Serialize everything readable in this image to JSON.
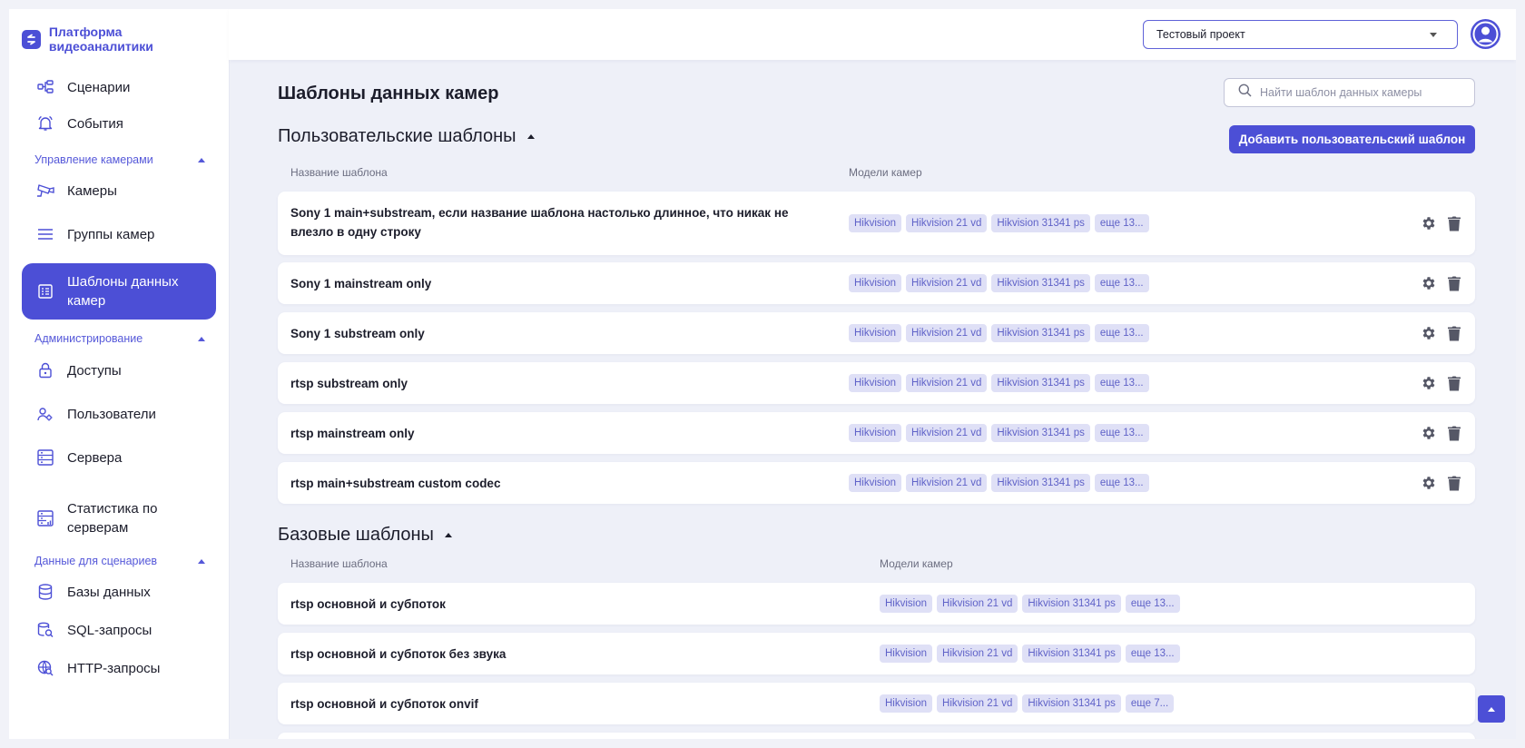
{
  "app": {
    "title": "Платформа видеоаналитики"
  },
  "sidebar": {
    "items": [
      {
        "label": "Сценарии",
        "icon": "scenarios-icon"
      },
      {
        "label": "События",
        "icon": "bell-icon"
      }
    ],
    "sections": [
      {
        "title": "Управление камерами",
        "items": [
          {
            "label": "Камеры",
            "icon": "camera-icon"
          },
          {
            "label": "Группы камер",
            "icon": "list-icon"
          },
          {
            "label": "Шаблоны данных камер",
            "icon": "template-icon",
            "active": true
          }
        ]
      },
      {
        "title": "Администрирование",
        "items": [
          {
            "label": "Доступы",
            "icon": "lock-icon"
          },
          {
            "label": "Пользователи",
            "icon": "users-icon"
          },
          {
            "label": "Сервера",
            "icon": "server-icon"
          },
          {
            "label": "Статистика по серверам",
            "icon": "server-stats-icon"
          }
        ]
      },
      {
        "title": "Данные для сценариев",
        "items": [
          {
            "label": "Базы данных",
            "icon": "database-icon"
          },
          {
            "label": "SQL-запросы",
            "icon": "sql-icon"
          },
          {
            "label": "HTTP-запросы",
            "icon": "http-icon"
          }
        ]
      }
    ]
  },
  "header": {
    "project": "Тестовый проект"
  },
  "main": {
    "title": "Шаблоны данных камер",
    "search_placeholder": "Найти шаблон данных камеры",
    "custom": {
      "title": "Пользовательские шаблоны",
      "add_label": "Добавить пользовательский шаблон",
      "col_name": "Название шаблона",
      "col_models": "Модели камер",
      "rows": [
        {
          "name": "Sony 1  main+substream, если название шаблона настолько длинное, что никак не влезло в одну строку",
          "tags": [
            "Hikvision",
            "Hikvision 21 vd",
            "Hikvision 31341 ps",
            "еще 13..."
          ]
        },
        {
          "name": "Sony 1  mainstream only",
          "tags": [
            "Hikvision",
            "Hikvision 21 vd",
            "Hikvision 31341 ps",
            "еще 13..."
          ]
        },
        {
          "name": "Sony 1  substream only",
          "tags": [
            "Hikvision",
            "Hikvision 21 vd",
            "Hikvision 31341 ps",
            "еще 13..."
          ]
        },
        {
          "name": "rtsp substream only",
          "tags": [
            "Hikvision",
            "Hikvision 21 vd",
            "Hikvision 31341 ps",
            "еще 13..."
          ]
        },
        {
          "name": "rtsp mainstream only",
          "tags": [
            "Hikvision",
            "Hikvision 21 vd",
            "Hikvision 31341 ps",
            "еще 13..."
          ]
        },
        {
          "name": "rtsp main+substream custom codec",
          "tags": [
            "Hikvision",
            "Hikvision 21 vd",
            "Hikvision 31341 ps",
            "еще 13..."
          ]
        }
      ]
    },
    "base": {
      "title": "Базовые шаблоны",
      "col_name": "Название шаблона",
      "col_models": "Модели камер",
      "rows": [
        {
          "name": "rtsp основной и субпоток",
          "tags": [
            "Hikvision",
            "Hikvision 21 vd",
            "Hikvision 31341 ps",
            "еще 13..."
          ]
        },
        {
          "name": "rtsp основной и субпоток без звука",
          "tags": [
            "Hikvision",
            "Hikvision 21 vd",
            "Hikvision 31341 ps",
            "еще 13..."
          ]
        },
        {
          "name": "rtsp основной и субпоток onvif",
          "tags": [
            "Hikvision",
            "Hikvision 21 vd",
            "Hikvision 31341 ps",
            "еще 7..."
          ]
        }
      ]
    }
  },
  "colors": {
    "accent": "#4c4fd6",
    "tag_bg": "#dfe0f6",
    "tag_text": "#5f62c8",
    "bg": "#eef0f8"
  }
}
